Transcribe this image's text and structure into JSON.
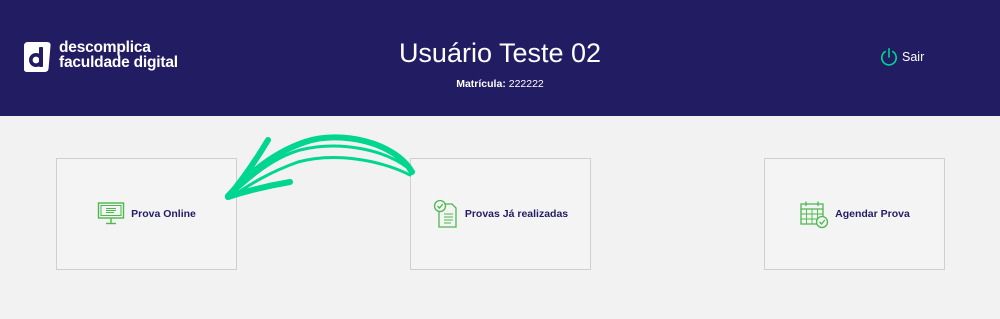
{
  "header": {
    "logo_icon": "descomplica-d-logo-icon",
    "logo_line1": "descomplica",
    "logo_line2": "faculdade digital",
    "user_name": "Usuário Teste 02",
    "matricula_label": "Matrícula:",
    "matricula_value": "222222",
    "logout_icon": "power-icon",
    "logout_label": "Sair"
  },
  "cards": [
    {
      "icon": "monitor-icon",
      "label": "Prova Online"
    },
    {
      "icon": "checked-document-icon",
      "label": "Provas Já realizadas"
    },
    {
      "icon": "calendar-check-icon",
      "label": "Agendar Prova"
    }
  ],
  "annotation": {
    "icon": "hand-drawn-arrow-icon"
  },
  "colors": {
    "header_bg": "#221c63",
    "page_bg": "#f2f2f2",
    "accent_green": "#00d68f",
    "icon_green": "#4db84d",
    "card_label": "#221c63"
  }
}
